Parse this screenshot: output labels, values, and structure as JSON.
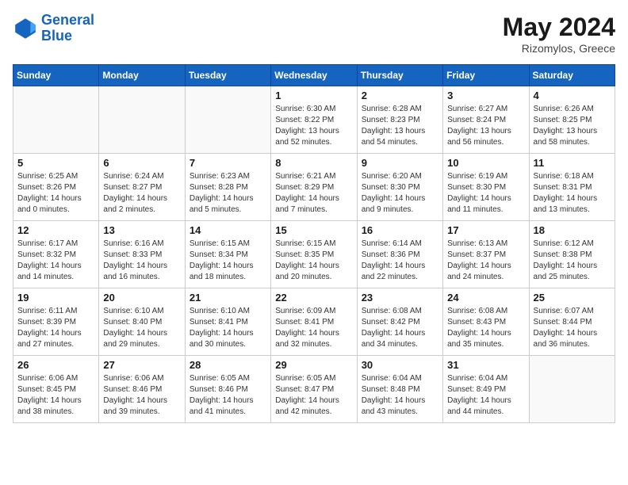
{
  "header": {
    "logo_line1": "General",
    "logo_line2": "Blue",
    "month_year": "May 2024",
    "location": "Rizomylos, Greece"
  },
  "days_of_week": [
    "Sunday",
    "Monday",
    "Tuesday",
    "Wednesday",
    "Thursday",
    "Friday",
    "Saturday"
  ],
  "weeks": [
    [
      {
        "day": "",
        "info": ""
      },
      {
        "day": "",
        "info": ""
      },
      {
        "day": "",
        "info": ""
      },
      {
        "day": "1",
        "info": "Sunrise: 6:30 AM\nSunset: 8:22 PM\nDaylight: 13 hours\nand 52 minutes."
      },
      {
        "day": "2",
        "info": "Sunrise: 6:28 AM\nSunset: 8:23 PM\nDaylight: 13 hours\nand 54 minutes."
      },
      {
        "day": "3",
        "info": "Sunrise: 6:27 AM\nSunset: 8:24 PM\nDaylight: 13 hours\nand 56 minutes."
      },
      {
        "day": "4",
        "info": "Sunrise: 6:26 AM\nSunset: 8:25 PM\nDaylight: 13 hours\nand 58 minutes."
      }
    ],
    [
      {
        "day": "5",
        "info": "Sunrise: 6:25 AM\nSunset: 8:26 PM\nDaylight: 14 hours\nand 0 minutes."
      },
      {
        "day": "6",
        "info": "Sunrise: 6:24 AM\nSunset: 8:27 PM\nDaylight: 14 hours\nand 2 minutes."
      },
      {
        "day": "7",
        "info": "Sunrise: 6:23 AM\nSunset: 8:28 PM\nDaylight: 14 hours\nand 5 minutes."
      },
      {
        "day": "8",
        "info": "Sunrise: 6:21 AM\nSunset: 8:29 PM\nDaylight: 14 hours\nand 7 minutes."
      },
      {
        "day": "9",
        "info": "Sunrise: 6:20 AM\nSunset: 8:30 PM\nDaylight: 14 hours\nand 9 minutes."
      },
      {
        "day": "10",
        "info": "Sunrise: 6:19 AM\nSunset: 8:30 PM\nDaylight: 14 hours\nand 11 minutes."
      },
      {
        "day": "11",
        "info": "Sunrise: 6:18 AM\nSunset: 8:31 PM\nDaylight: 14 hours\nand 13 minutes."
      }
    ],
    [
      {
        "day": "12",
        "info": "Sunrise: 6:17 AM\nSunset: 8:32 PM\nDaylight: 14 hours\nand 14 minutes."
      },
      {
        "day": "13",
        "info": "Sunrise: 6:16 AM\nSunset: 8:33 PM\nDaylight: 14 hours\nand 16 minutes."
      },
      {
        "day": "14",
        "info": "Sunrise: 6:15 AM\nSunset: 8:34 PM\nDaylight: 14 hours\nand 18 minutes."
      },
      {
        "day": "15",
        "info": "Sunrise: 6:15 AM\nSunset: 8:35 PM\nDaylight: 14 hours\nand 20 minutes."
      },
      {
        "day": "16",
        "info": "Sunrise: 6:14 AM\nSunset: 8:36 PM\nDaylight: 14 hours\nand 22 minutes."
      },
      {
        "day": "17",
        "info": "Sunrise: 6:13 AM\nSunset: 8:37 PM\nDaylight: 14 hours\nand 24 minutes."
      },
      {
        "day": "18",
        "info": "Sunrise: 6:12 AM\nSunset: 8:38 PM\nDaylight: 14 hours\nand 25 minutes."
      }
    ],
    [
      {
        "day": "19",
        "info": "Sunrise: 6:11 AM\nSunset: 8:39 PM\nDaylight: 14 hours\nand 27 minutes."
      },
      {
        "day": "20",
        "info": "Sunrise: 6:10 AM\nSunset: 8:40 PM\nDaylight: 14 hours\nand 29 minutes."
      },
      {
        "day": "21",
        "info": "Sunrise: 6:10 AM\nSunset: 8:41 PM\nDaylight: 14 hours\nand 30 minutes."
      },
      {
        "day": "22",
        "info": "Sunrise: 6:09 AM\nSunset: 8:41 PM\nDaylight: 14 hours\nand 32 minutes."
      },
      {
        "day": "23",
        "info": "Sunrise: 6:08 AM\nSunset: 8:42 PM\nDaylight: 14 hours\nand 34 minutes."
      },
      {
        "day": "24",
        "info": "Sunrise: 6:08 AM\nSunset: 8:43 PM\nDaylight: 14 hours\nand 35 minutes."
      },
      {
        "day": "25",
        "info": "Sunrise: 6:07 AM\nSunset: 8:44 PM\nDaylight: 14 hours\nand 36 minutes."
      }
    ],
    [
      {
        "day": "26",
        "info": "Sunrise: 6:06 AM\nSunset: 8:45 PM\nDaylight: 14 hours\nand 38 minutes."
      },
      {
        "day": "27",
        "info": "Sunrise: 6:06 AM\nSunset: 8:46 PM\nDaylight: 14 hours\nand 39 minutes."
      },
      {
        "day": "28",
        "info": "Sunrise: 6:05 AM\nSunset: 8:46 PM\nDaylight: 14 hours\nand 41 minutes."
      },
      {
        "day": "29",
        "info": "Sunrise: 6:05 AM\nSunset: 8:47 PM\nDaylight: 14 hours\nand 42 minutes."
      },
      {
        "day": "30",
        "info": "Sunrise: 6:04 AM\nSunset: 8:48 PM\nDaylight: 14 hours\nand 43 minutes."
      },
      {
        "day": "31",
        "info": "Sunrise: 6:04 AM\nSunset: 8:49 PM\nDaylight: 14 hours\nand 44 minutes."
      },
      {
        "day": "",
        "info": ""
      }
    ]
  ]
}
